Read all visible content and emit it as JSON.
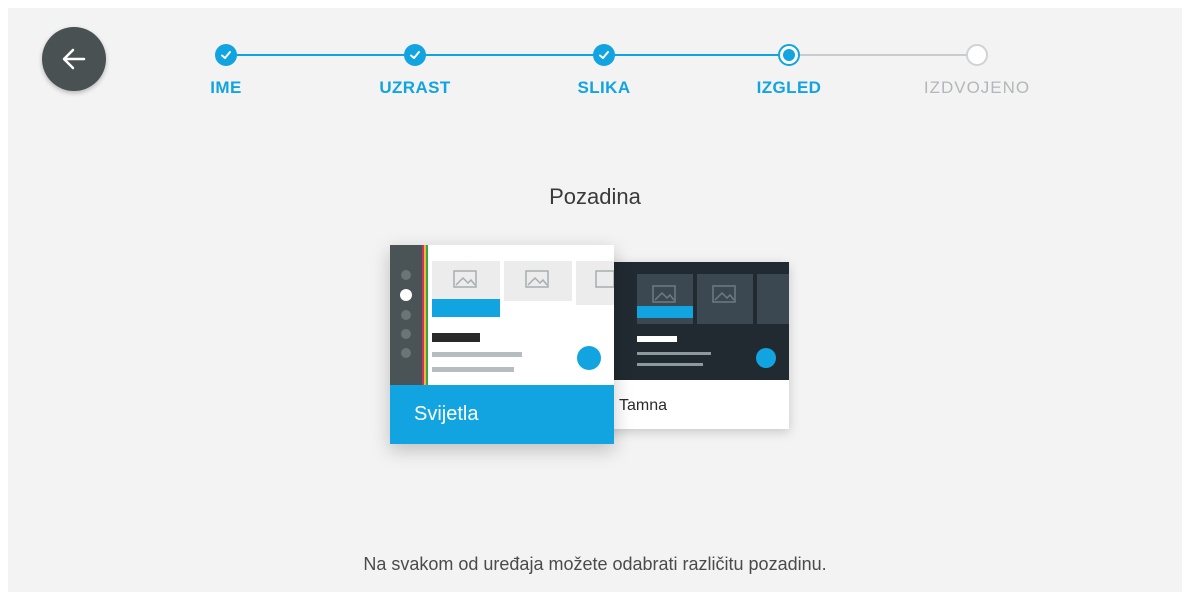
{
  "navigation": {
    "back_icon": "arrow-left-icon",
    "back_button_color": "#4a5153"
  },
  "stepper": {
    "accent_color": "#12a4e1",
    "steps": [
      {
        "label": "IME",
        "state": "done"
      },
      {
        "label": "UZRAST",
        "state": "done"
      },
      {
        "label": "SLIKA",
        "state": "done"
      },
      {
        "label": "IZGLED",
        "state": "current"
      },
      {
        "label": "IZDVOJENO",
        "state": "todo"
      }
    ]
  },
  "main": {
    "title": "Pozadina",
    "options": {
      "light": {
        "label": "Svijetla",
        "selected": true
      },
      "dark": {
        "label": "Tamna",
        "selected": false
      }
    },
    "hint": "Na svakom od uređaja možete odabrati različitu pozadinu."
  }
}
